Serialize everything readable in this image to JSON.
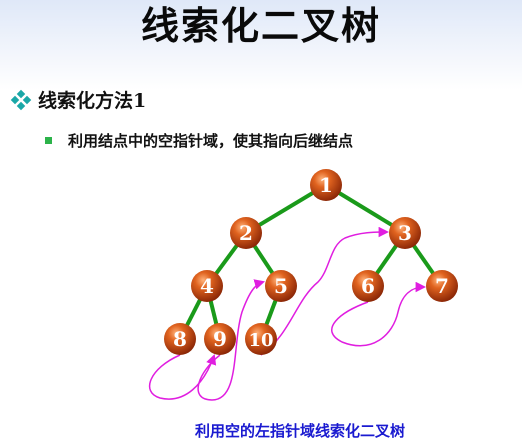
{
  "slide": {
    "title": "线索化二叉树",
    "bullet1": "线索化方法1",
    "bullet2": "利用结点中的空指针域，使其指向后继结点",
    "caption": "利用空的左指针域线索化二叉树"
  },
  "colors": {
    "node_fill": "#c8420e",
    "edge": "#1a9a1a",
    "thread": "#e01ee0",
    "caption": "#1a1ad0"
  },
  "tree": {
    "nodes": [
      {
        "id": "n1",
        "label": "1"
      },
      {
        "id": "n2",
        "label": "2"
      },
      {
        "id": "n3",
        "label": "3"
      },
      {
        "id": "n4",
        "label": "4"
      },
      {
        "id": "n5",
        "label": "5"
      },
      {
        "id": "n6",
        "label": "6"
      },
      {
        "id": "n7",
        "label": "7"
      },
      {
        "id": "n8",
        "label": "8"
      },
      {
        "id": "n9",
        "label": "9"
      },
      {
        "id": "n10",
        "label": "10"
      }
    ],
    "edges": [
      [
        "n1",
        "n2"
      ],
      [
        "n1",
        "n3"
      ],
      [
        "n2",
        "n4"
      ],
      [
        "n2",
        "n5"
      ],
      [
        "n3",
        "n6"
      ],
      [
        "n3",
        "n7"
      ],
      [
        "n4",
        "n8"
      ],
      [
        "n4",
        "n9"
      ],
      [
        "n5",
        "n10"
      ]
    ],
    "threads": [
      [
        "n8",
        "n9"
      ],
      [
        "n9",
        "n5"
      ],
      [
        "n10",
        "n3"
      ],
      [
        "n6",
        "n7"
      ]
    ]
  }
}
